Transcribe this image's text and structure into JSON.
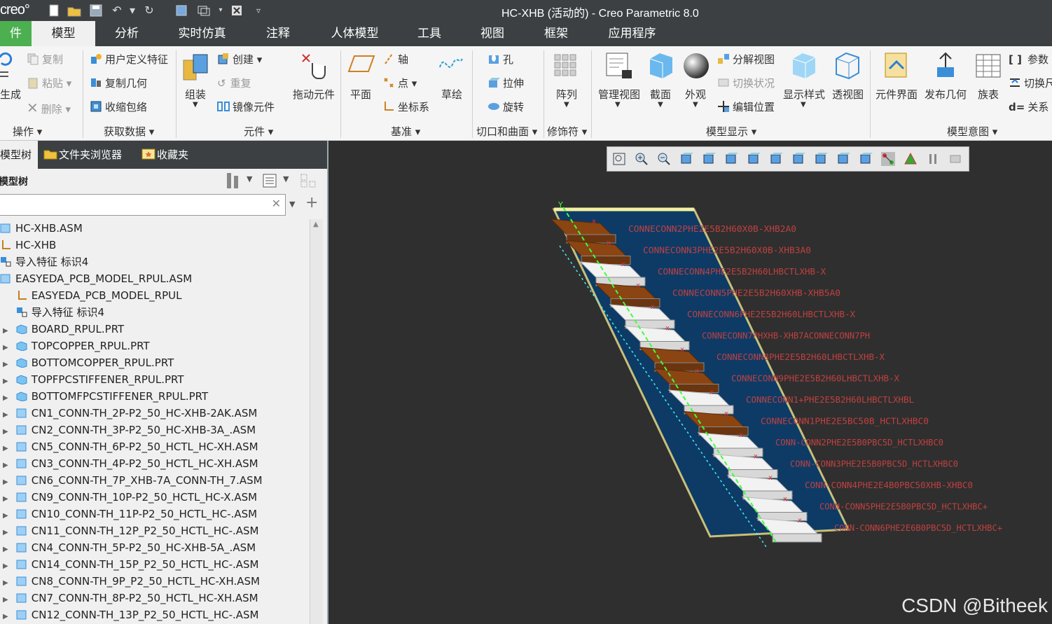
{
  "app": {
    "logo": "creo°",
    "window_title": "HC-XHB (活动的) - Creo Parametric 8.0"
  },
  "menu_tabs": [
    "件",
    "模型",
    "分析",
    "实时仿真",
    "注释",
    "人体模型",
    "工具",
    "视图",
    "框架",
    "应用程序"
  ],
  "ribbon": {
    "operations": {
      "regenerate": "生成",
      "copy": "复制",
      "paste": "粘贴",
      "delete": "删除",
      "label": "操作"
    },
    "get_data": {
      "udf": "用户定义特征",
      "copy_geom": "复制几何",
      "shrinkwrap": "收缩包络",
      "label": "获取数据"
    },
    "component": {
      "assemble": "组装",
      "create": "创建",
      "repeat": "重复",
      "mirror": "镜像元件",
      "drag": "拖动元件",
      "label": "元件"
    },
    "datum": {
      "plane": "平面",
      "axis": "轴",
      "point": "点",
      "csys": "坐标系",
      "sketch": "草绘",
      "label": "基准"
    },
    "cut_surface": {
      "hole": "孔",
      "extrude": "拉伸",
      "revolve": "旋转",
      "label": "切口和曲面"
    },
    "modifiers": {
      "pattern": "阵列",
      "label": "修饰符"
    },
    "model_display": {
      "manage_views": "管理视图",
      "section": "截面",
      "appearance": "外观",
      "explode": "分解视图",
      "toggle_status": "切换状况",
      "edit_position": "编辑位置",
      "display_style": "显示样式",
      "perspective": "透视图",
      "label": "模型显示"
    },
    "model_intent": {
      "component_interface": "元件界面",
      "publish_geom": "发布几何",
      "family_table": "族表",
      "parameters": "参数",
      "switch": "切换尺",
      "relations": "关系",
      "label": "模型意图"
    }
  },
  "panel_tabs": [
    "模型树",
    "文件夹浏览器",
    "收藏夹"
  ],
  "tree_header": "模型树",
  "search": {
    "value": ""
  },
  "tree": [
    {
      "label": "HC-XHB.ASM",
      "indent": 0,
      "icon": "assembly-icon",
      "expander": ""
    },
    {
      "label": "HC-XHB",
      "indent": 0,
      "icon": "csys-icon",
      "expander": ""
    },
    {
      "label": "导入特征 标识4",
      "indent": 0,
      "icon": "import-feature-icon",
      "expander": ""
    },
    {
      "label": "EASYEDA_PCB_MODEL_RPUL.ASM",
      "indent": 0,
      "icon": "assembly-icon",
      "expander": ""
    },
    {
      "label": "EASYEDA_PCB_MODEL_RPUL",
      "indent": 1,
      "icon": "csys-icon",
      "expander": ""
    },
    {
      "label": "导入特征 标识4",
      "indent": 1,
      "icon": "import-feature-icon",
      "expander": ""
    },
    {
      "label": "BOARD_RPUL.PRT",
      "indent": 1,
      "icon": "part-icon",
      "expander": "▶"
    },
    {
      "label": "TOPCOPPER_RPUL.PRT",
      "indent": 1,
      "icon": "part-icon",
      "expander": "▶"
    },
    {
      "label": "BOTTOMCOPPER_RPUL.PRT",
      "indent": 1,
      "icon": "part-icon",
      "expander": "▶"
    },
    {
      "label": "TOPFPCSTIFFENER_RPUL.PRT",
      "indent": 1,
      "icon": "part-icon",
      "expander": "▶"
    },
    {
      "label": "BOTTOMFPCSTIFFENER_RPUL.PRT",
      "indent": 1,
      "icon": "part-icon",
      "expander": "▶"
    },
    {
      "label": "CN1_CONN-TH_2P-P2_50_HC-XHB-2AK.ASM",
      "indent": 1,
      "icon": "assembly-icon",
      "expander": "▶"
    },
    {
      "label": "CN2_CONN-TH_3P-P2_50_HC-XHB-3A_.ASM",
      "indent": 1,
      "icon": "assembly-icon",
      "expander": "▶"
    },
    {
      "label": "CN5_CONN-TH_6P-P2_50_HCTL_HC-XH.ASM",
      "indent": 1,
      "icon": "assembly-icon",
      "expander": "▶"
    },
    {
      "label": "CN3_CONN-TH_4P-P2_50_HCTL_HC-XH.ASM",
      "indent": 1,
      "icon": "assembly-icon",
      "expander": "▶"
    },
    {
      "label": "CN6_CONN-TH_7P_XHB-7A_CONN-TH_7.ASM",
      "indent": 1,
      "icon": "assembly-icon",
      "expander": "▶"
    },
    {
      "label": "CN9_CONN-TH_10P-P2_50_HCTL_HC-X.ASM",
      "indent": 1,
      "icon": "assembly-icon",
      "expander": "▶"
    },
    {
      "label": "CN10_CONN-TH_11P-P2_50_HCTL_HC-.ASM",
      "indent": 1,
      "icon": "assembly-icon",
      "expander": "▶"
    },
    {
      "label": "CN11_CONN-TH_12P_P2_50_HCTL_HC-.ASM",
      "indent": 1,
      "icon": "assembly-icon",
      "expander": "▶"
    },
    {
      "label": "CN4_CONN-TH_5P-P2_50_HC-XHB-5A_.ASM",
      "indent": 1,
      "icon": "assembly-icon",
      "expander": "▶"
    },
    {
      "label": "CN14_CONN-TH_15P_P2_50_HCTL_HC-.ASM",
      "indent": 1,
      "icon": "assembly-icon",
      "expander": "▶"
    },
    {
      "label": "CN8_CONN-TH_9P_P2_50_HCTL_HC-XH.ASM",
      "indent": 1,
      "icon": "assembly-icon",
      "expander": "▶"
    },
    {
      "label": "CN7_CONN-TH_8P-P2_50_HCTL_HC-XH.ASM",
      "indent": 1,
      "icon": "assembly-icon",
      "expander": "▶"
    },
    {
      "label": "CN12_CONN-TH_13P_P2_50_HCTL_HC-.ASM",
      "indent": 1,
      "icon": "assembly-icon",
      "expander": "▶"
    }
  ],
  "viewport": {
    "background": "#2f2f2f",
    "board_color": "#0d3b66",
    "connector_brown": "#8b4513",
    "connector_white": "#f2f2f2",
    "rows": 15,
    "labels": [
      "CONNECONN2PHE2E5B2H60X0B-XHB2A0",
      "CONNECONN3PHE2E5B2H60X0B-XHB3A0",
      "CONNECONN4PHE2E5B2H60LHBCTLXHB-X",
      "CONNECONN5PHE2E5B2H60XHB-XHB5A0",
      "CONNECONN6PHE2E5B2H60LHBCTLXHB-X",
      "CONNECONN7PHXHB-XHB7ACONNECONN7PH",
      "CONNECONN8PHE2E5B2H60LHBCTLXHB-X",
      "CONNECONN9PHE2E5B2H60LHBCTLXHB-X",
      "CONNECONN1+PHE2E5B2H60LHBCTLXHBL",
      "CONNECONN1PHE2E5BC50B_HCTLXHBC0",
      "CONN-CONN2PHE2E5B0PBC5D_HCTLXHBC0",
      "CONN-CONN3PHE2E5B0PBC5D_HCTLXHBC0",
      "CONN-CONN4PHE2E4B0PBC50XHB-XHBC0",
      "CONN-CONN5PHE2E5B0PBC5D_HCTLXHBC+",
      "CONN-CONN6PHE2E6B0PBC5D_HCTLXHBC+"
    ]
  },
  "watermark": "CSDN @Bitheek"
}
